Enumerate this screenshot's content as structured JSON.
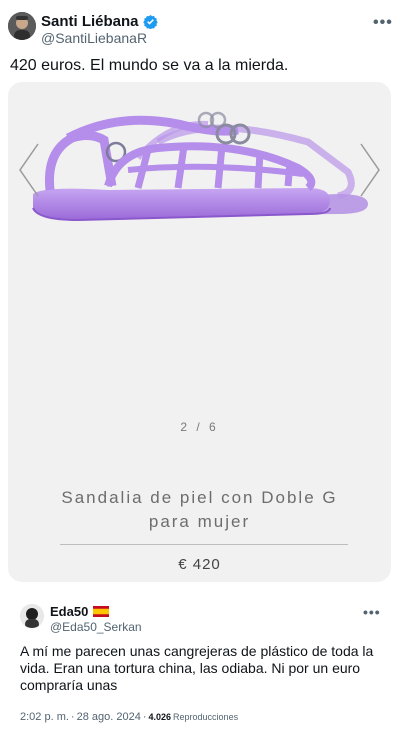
{
  "tweet": {
    "author_name": "Santi Liébana",
    "author_handle": "@SantiLiebanaR",
    "text": "420 euros. El mundo se va a la mierda.",
    "more_icon": "more-dots-icon",
    "verified_icon": "verified-badge-icon",
    "verified_color": "#1d9bf0"
  },
  "product_card": {
    "pager": "2 / 6",
    "title_line1": "Sandalia de piel con Doble G",
    "title_line2": "para mujer",
    "price": "€ 420",
    "sandal_color": "#a77ee0",
    "background_color": "#f1f1f1"
  },
  "reply": {
    "author_name": "Eda50",
    "author_handle": "@Eda50_Serkan",
    "flag_icon": "spain-flag-icon",
    "text": "A mí me parecen unas cangrejeras de plástico de toda la vida. Eran una tortura china, las odiaba. Ni por un euro compraría unas",
    "time": "2:02 p. m.",
    "separator": " · ",
    "date": "28 ago. 2024",
    "views_count": "4.026",
    "views_label": "Reproducciones"
  }
}
